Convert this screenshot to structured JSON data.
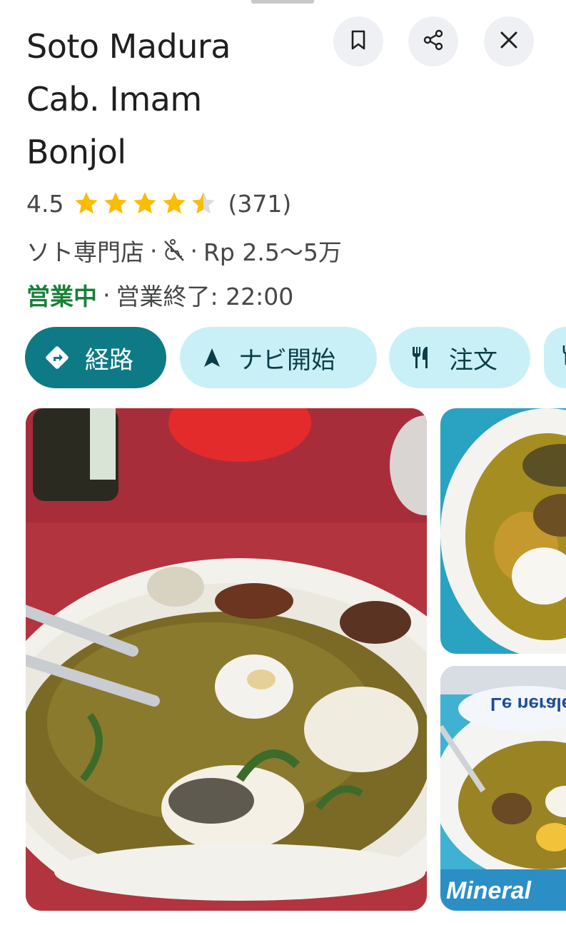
{
  "place": {
    "title_lines": [
      "Soto Madura",
      "Cab. Imam",
      "Bonjol"
    ],
    "rating": "4.5",
    "rating_value": 4.5,
    "review_count": "(371)",
    "category": "ソト専門店",
    "price_range": "Rp 2.5〜5万",
    "status_open": "営業中",
    "status_detail": "営業終了: 22:00",
    "separator": "·"
  },
  "header_actions": {
    "save_icon": "bookmark-icon",
    "share_icon": "share-icon",
    "close_icon": "close-icon"
  },
  "accessibility_icon": "not-wheelchair-accessible-icon",
  "chips": [
    {
      "label": "経路",
      "icon": "directions-icon"
    },
    {
      "label": "ナビ開始",
      "icon": "navigation-arrow-icon"
    },
    {
      "label": "注文",
      "icon": "restaurant-icon"
    }
  ],
  "colors": {
    "accent": "#0e7a86",
    "chip_bg": "#c9f0f7",
    "open_green": "#188038",
    "star": "#fbbc04"
  },
  "photos": {
    "sign_text": "Mineral",
    "sign_text_mirrored": "Le nerale"
  }
}
